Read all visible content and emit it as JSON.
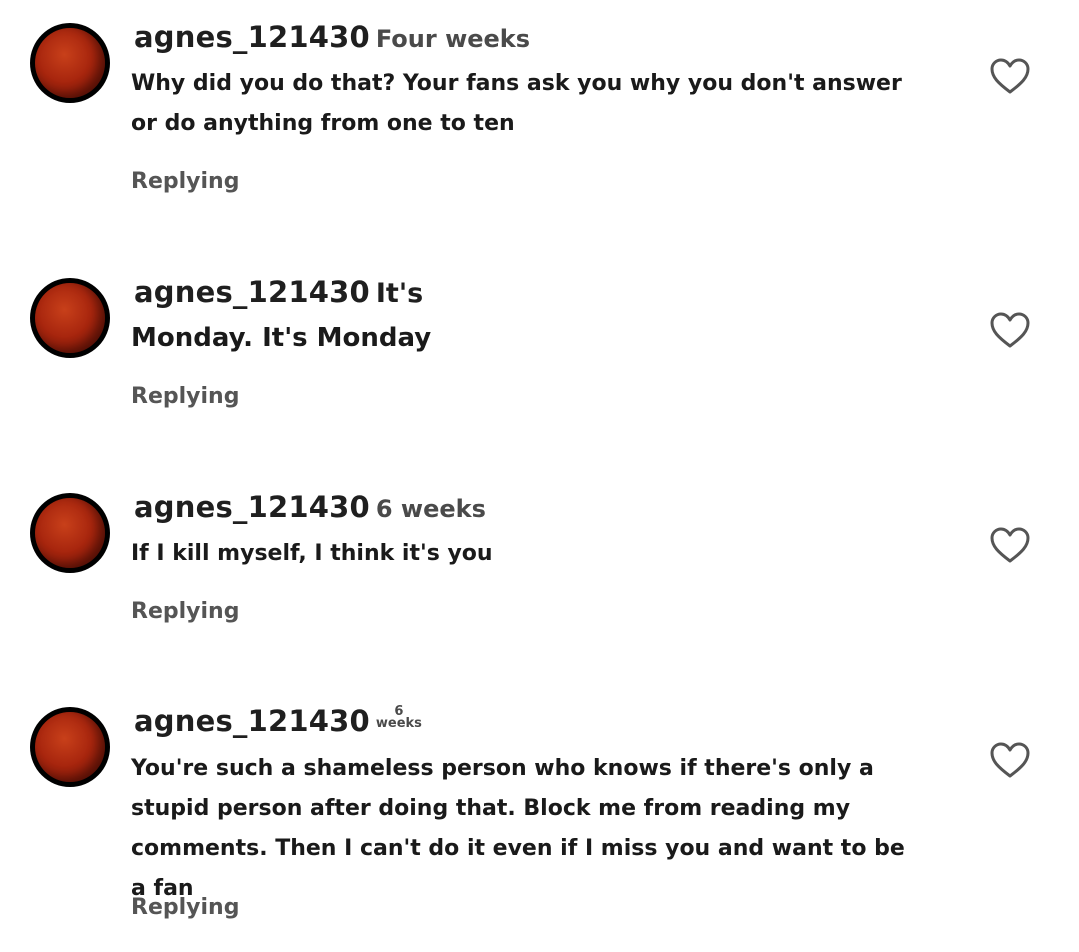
{
  "comments": [
    {
      "username": "agnes_121430",
      "time": "Four weeks",
      "text": "Why did you do that? Your fans ask you why you don't answer or do anything from one to ten",
      "reply_label": "Replying"
    },
    {
      "username": "agnes_121430",
      "time": "It's",
      "text": "Monday. It's Monday",
      "reply_label": "Replying"
    },
    {
      "username": "agnes_121430",
      "time": "6 weeks",
      "text": "If I kill myself, I think it's you",
      "reply_label": "Replying"
    },
    {
      "username": "agnes_121430",
      "time_number": "6",
      "time_unit": "weeks",
      "text": "You're such a shameless person who knows if there's only a stupid person after doing that. Block me from reading my comments. Then I can't do it even if I miss you and want to be a fan",
      "reply_label": "Replying"
    }
  ],
  "icons": {
    "avatar": "blood-moon-avatar",
    "like": "heart-outline-icon"
  },
  "colors": {
    "avatar_ring": "#000000",
    "avatar_moon": "#a8260e",
    "heart_stroke": "#555555",
    "reply_text": "#555555"
  }
}
